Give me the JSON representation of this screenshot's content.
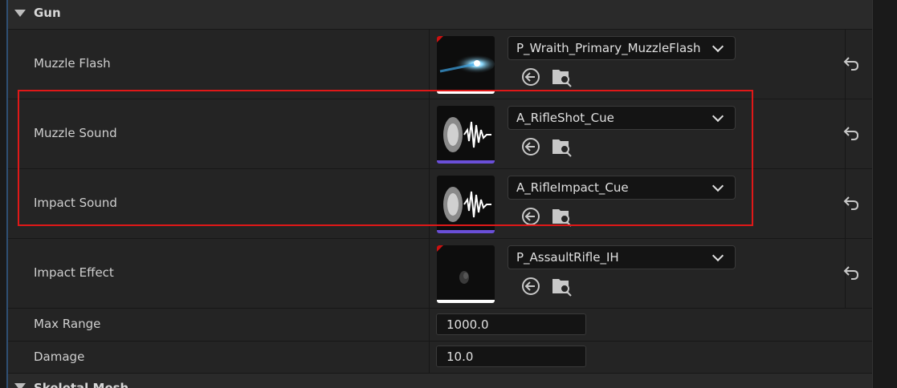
{
  "category": {
    "title": "Gun"
  },
  "next_category": {
    "title": "Skeletal Mesh"
  },
  "asset_rows": [
    {
      "label": "Muzzle Flash",
      "value": "P_Wraith_Primary_MuzzleFlash",
      "thumb_icon": "particle-flash-icon",
      "bar_color": "#ffffff"
    },
    {
      "label": "Muzzle Sound",
      "value": "A_RifleShot_Cue",
      "thumb_icon": "sound-wave-icon",
      "bar_color": "#6a4fd8"
    },
    {
      "label": "Impact Sound",
      "value": "A_RifleImpact_Cue",
      "thumb_icon": "sound-wave-icon",
      "bar_color": "#6a4fd8"
    },
    {
      "label": "Impact Effect",
      "value": "P_AssaultRifle_IH",
      "thumb_icon": "particle-smoke-icon",
      "bar_color": "#ffffff"
    }
  ],
  "numeric_rows": [
    {
      "label": "Max Range",
      "value": "1000.0"
    },
    {
      "label": "Damage",
      "value": "10.0"
    }
  ],
  "colors": {
    "highlight": "#e01818",
    "accent_thumb_corner": "#cc1010"
  }
}
